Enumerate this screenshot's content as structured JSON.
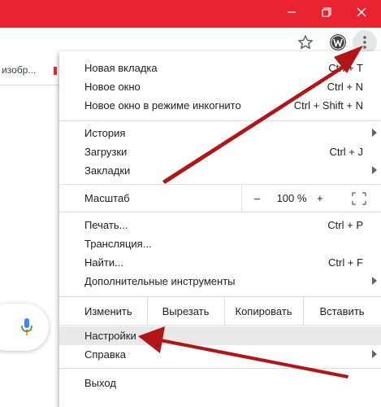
{
  "window": {
    "controls": [
      "minimize",
      "restore",
      "close"
    ],
    "titlebar_color": "#e8232f"
  },
  "toolbar": {
    "icons": [
      "star-icon",
      "wordpress-icon",
      "kebab-menu-icon"
    ]
  },
  "page": {
    "bookmark_partial": "изобр..."
  },
  "menu": {
    "new_tab": {
      "label": "Новая вкладка",
      "shortcut": "Ctrl + T"
    },
    "new_window": {
      "label": "Новое окно",
      "shortcut": "Ctrl + N"
    },
    "incognito": {
      "label": "Новое окно в режиме инкогнито",
      "shortcut": "Ctrl + Shift + N"
    },
    "history": {
      "label": "История"
    },
    "downloads": {
      "label": "Загрузки",
      "shortcut": "Ctrl + J"
    },
    "bookmarks": {
      "label": "Закладки"
    },
    "zoom": {
      "label": "Масштаб",
      "minus": "–",
      "value": "100 %",
      "plus": "+"
    },
    "print": {
      "label": "Печать...",
      "shortcut": "Ctrl + P"
    },
    "cast": {
      "label": "Трансляция..."
    },
    "find": {
      "label": "Найти...",
      "shortcut": "Ctrl + F"
    },
    "more_tools": {
      "label": "Дополнительные инструменты"
    },
    "edit": {
      "label": "Изменить",
      "cut": "Вырезать",
      "copy": "Копировать",
      "paste": "Вставить"
    },
    "settings": {
      "label": "Настройки"
    },
    "help": {
      "label": "Справка"
    },
    "exit": {
      "label": "Выход"
    }
  },
  "annotation_color": "#b21516"
}
